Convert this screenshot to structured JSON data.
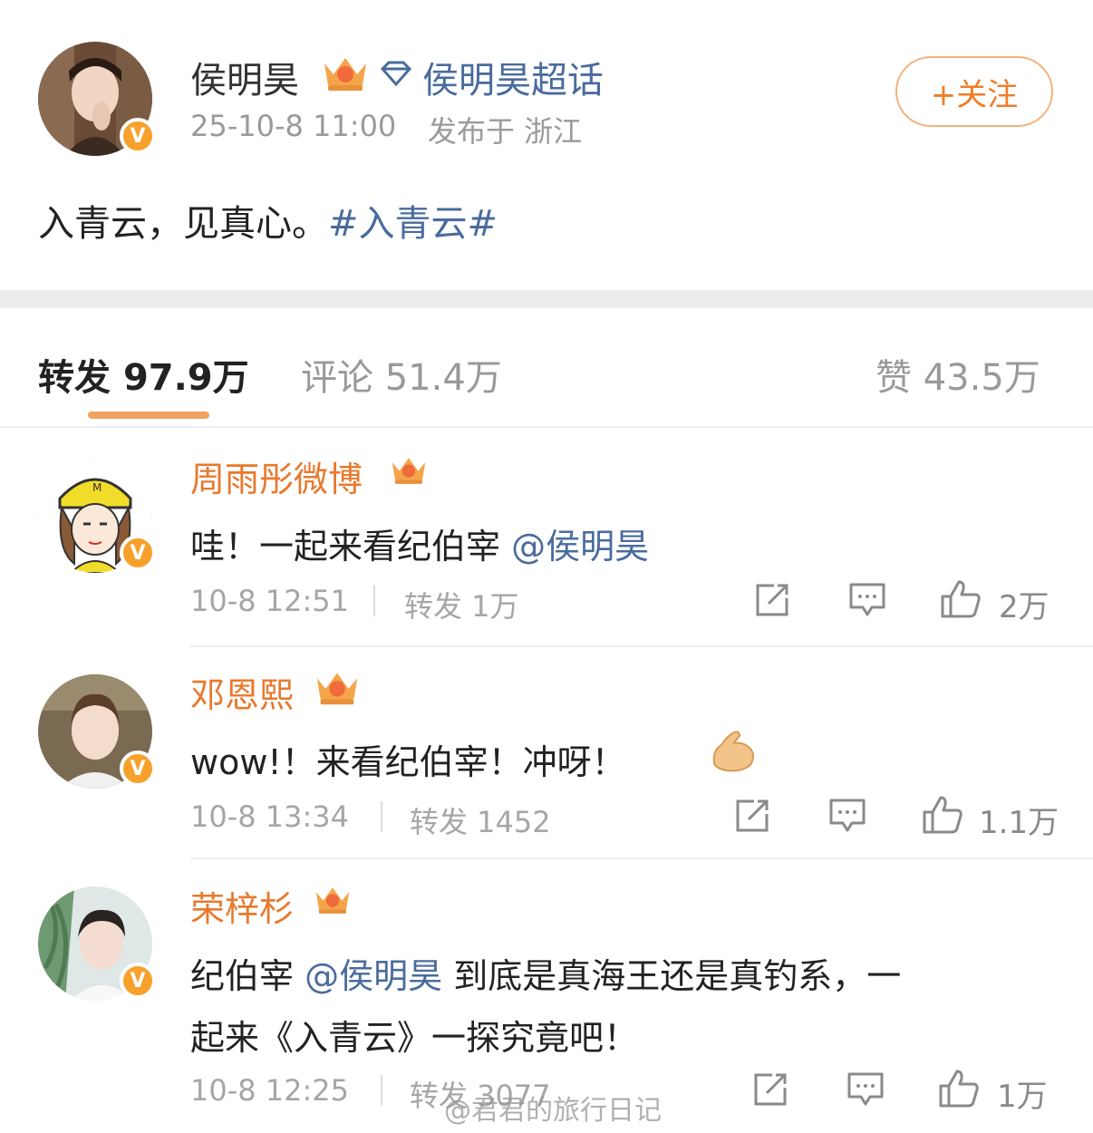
{
  "post": {
    "author": "侯明昊",
    "supertopic": "侯明昊超话",
    "time": "25-10-8 11:00",
    "location": "发布于 浙江",
    "follow_label": "+关注",
    "text": "入青云，见真心。",
    "hashtag": "#入青云#"
  },
  "tabs": {
    "repost_label": "转发",
    "repost_count": "97.9万",
    "comment_label": "评论",
    "comment_count": "51.4万",
    "like_label": "赞",
    "like_count": "43.5万"
  },
  "comments": [
    {
      "name": "周雨彤微博",
      "text": "哇！一起来看纪伯宰",
      "mention": "@侯明昊",
      "time": "10-8 12:51",
      "repost": "转发 1万",
      "likes": "2万"
    },
    {
      "name": "邓恩熙",
      "text": "wow!！来看纪伯宰！冲呀！",
      "time": "10-8 13:34",
      "repost": "转发 1452",
      "likes": "1.1万"
    },
    {
      "name": "荣梓杉",
      "text_part1": "纪伯宰",
      "mention": "@侯明昊",
      "text_part2": "到底是真海王还是真钓系，一",
      "text_line2": "起来《入青云》一探究竟吧！",
      "time": "10-8 12:25",
      "repost": "转发 3077",
      "likes": "1万"
    }
  ],
  "watermark": "@君君的旅行日记",
  "colors": {
    "accent_orange": "#ef7e27",
    "link_blue": "#4a6c9c",
    "verified_badge": "#f7a02a"
  }
}
